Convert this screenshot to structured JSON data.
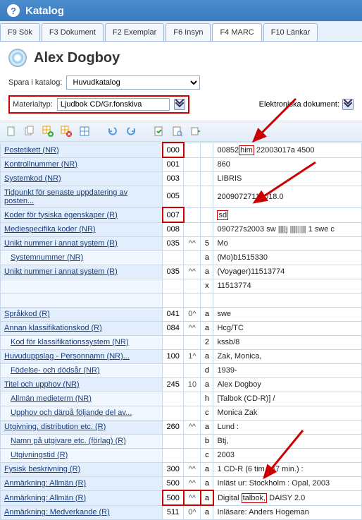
{
  "window": {
    "title": "Katalog"
  },
  "tabs": [
    {
      "label": "F9 Sök"
    },
    {
      "label": "F3 Dokument"
    },
    {
      "label": "F2 Exemplar"
    },
    {
      "label": "F6 Insyn"
    },
    {
      "label": "F4 MARC"
    },
    {
      "label": "F10 Länkar"
    }
  ],
  "header": {
    "title": "Alex Dogboy"
  },
  "form": {
    "katalog_label": "Spara i katalog:",
    "katalog_value": "Huvudkatalog",
    "materialtyp_label": "Materialtyp:",
    "materialtyp_value": "Ljudbok CD/Gr.fonskiva",
    "elektroniska_label": "Elektroniska dokument:"
  },
  "rows": [
    {
      "t": "main",
      "label": "Postetikett (NR)",
      "tag": "000",
      "ind": "",
      "sf": "",
      "val": "00852him  22003017a 4500",
      "tag_red": true,
      "val_red_range": "him"
    },
    {
      "t": "main",
      "label": "Kontrollnummer (NR)",
      "tag": "001",
      "ind": "",
      "sf": "",
      "val": "860"
    },
    {
      "t": "main",
      "label": "Systemkod (NR)",
      "tag": "003",
      "ind": "",
      "sf": "",
      "val": "LIBRIS"
    },
    {
      "t": "main",
      "label": "Tidpunkt för senaste uppdatering av posten...",
      "tag": "005",
      "ind": "",
      "sf": "",
      "val": "20090727112018.0"
    },
    {
      "t": "main",
      "label": "Koder för fysiska egenskaper (R)",
      "tag": "007",
      "ind": "",
      "sf": "",
      "val": "sd",
      "tag_red": true,
      "val_red": true
    },
    {
      "t": "main",
      "label": "Mediespecifika koder (NR)",
      "tag": "008",
      "ind": "",
      "sf": "",
      "val": "090727s2003    sw ||||j |||||||| 1 swe c"
    },
    {
      "t": "main",
      "label": "Unikt nummer i annat system (R)",
      "tag": "035",
      "ind": "^^",
      "sf": "5",
      "val": "Mo"
    },
    {
      "t": "sub",
      "label": "Systemnummer (NR)",
      "tag": "",
      "ind": "",
      "sf": "a",
      "val": "(Mo)b1515330"
    },
    {
      "t": "main",
      "label": "Unikt nummer i annat system (R)",
      "tag": "035",
      "ind": "^^",
      "sf": "a",
      "val": "(Voyager)11513774"
    },
    {
      "t": "sub",
      "label": "",
      "tag": "",
      "ind": "",
      "sf": "x",
      "val": "11513774"
    },
    {
      "t": "sub",
      "label": "",
      "tag": "",
      "ind": "",
      "sf": "",
      "val": ""
    },
    {
      "t": "main",
      "label": "Språkkod (R)",
      "tag": "041",
      "ind": "0^",
      "sf": "a",
      "val": "swe"
    },
    {
      "t": "main",
      "label": "Annan klassifikationskod (R)",
      "tag": "084",
      "ind": "^^",
      "sf": "a",
      "val": "Hcg/TC"
    },
    {
      "t": "sub",
      "label": "Kod för klassifikationssystem (NR)",
      "tag": "",
      "ind": "",
      "sf": "2",
      "val": "kssb/8"
    },
    {
      "t": "main",
      "label": "Huvuduppslag - Personnamn (NR)...",
      "tag": "100",
      "ind": "1^",
      "sf": "a",
      "val": "Zak, Monica,"
    },
    {
      "t": "sub",
      "label": "Födelse- och dödsår (NR)",
      "tag": "",
      "ind": "",
      "sf": "d",
      "val": "1939-"
    },
    {
      "t": "main",
      "label": "Titel och upphov (NR)",
      "tag": "245",
      "ind": "10",
      "sf": "a",
      "val": "Alex Dogboy"
    },
    {
      "t": "sub",
      "label": "Allmän medieterm (NR)",
      "tag": "",
      "ind": "",
      "sf": "h",
      "val": "[Talbok (CD-R)] /"
    },
    {
      "t": "sub",
      "label": "Upphov och därpå följande del av...",
      "tag": "",
      "ind": "",
      "sf": "c",
      "val": "Monica Zak"
    },
    {
      "t": "main",
      "label": "Utgivning, distribution etc. (R)",
      "tag": "260",
      "ind": "^^",
      "sf": "a",
      "val": "Lund :"
    },
    {
      "t": "sub",
      "label": "Namn på utgivare etc. (förlag) (R)",
      "tag": "",
      "ind": "",
      "sf": "b",
      "val": "Btj,"
    },
    {
      "t": "sub",
      "label": "Utgivningstid (R)",
      "tag": "",
      "ind": "",
      "sf": "c",
      "val": "2003"
    },
    {
      "t": "main",
      "label": "Fysisk beskrivning (R)",
      "tag": "300",
      "ind": "^^",
      "sf": "a",
      "val": "1 CD-R (6 tim., 47 min.) :"
    },
    {
      "t": "main",
      "label": "Anmärkning: Allmän (R)",
      "tag": "500",
      "ind": "^^",
      "sf": "a",
      "val": "Inläst ur: Stockholm : Opal, 2003"
    },
    {
      "t": "main",
      "label": "Anmärkning: Allmän (R)",
      "tag": "500",
      "ind": "^^",
      "sf": "a",
      "val": "Digital talbok, DAISY 2.0",
      "tag_red": true,
      "ind_red": true,
      "sf_red": true,
      "val_red_word": "talbok,"
    },
    {
      "t": "main",
      "label": "Anmärkning: Medverkande (R)",
      "tag": "511",
      "ind": "0^",
      "sf": "a",
      "val": "Inläsare: Anders Hogeman"
    }
  ]
}
